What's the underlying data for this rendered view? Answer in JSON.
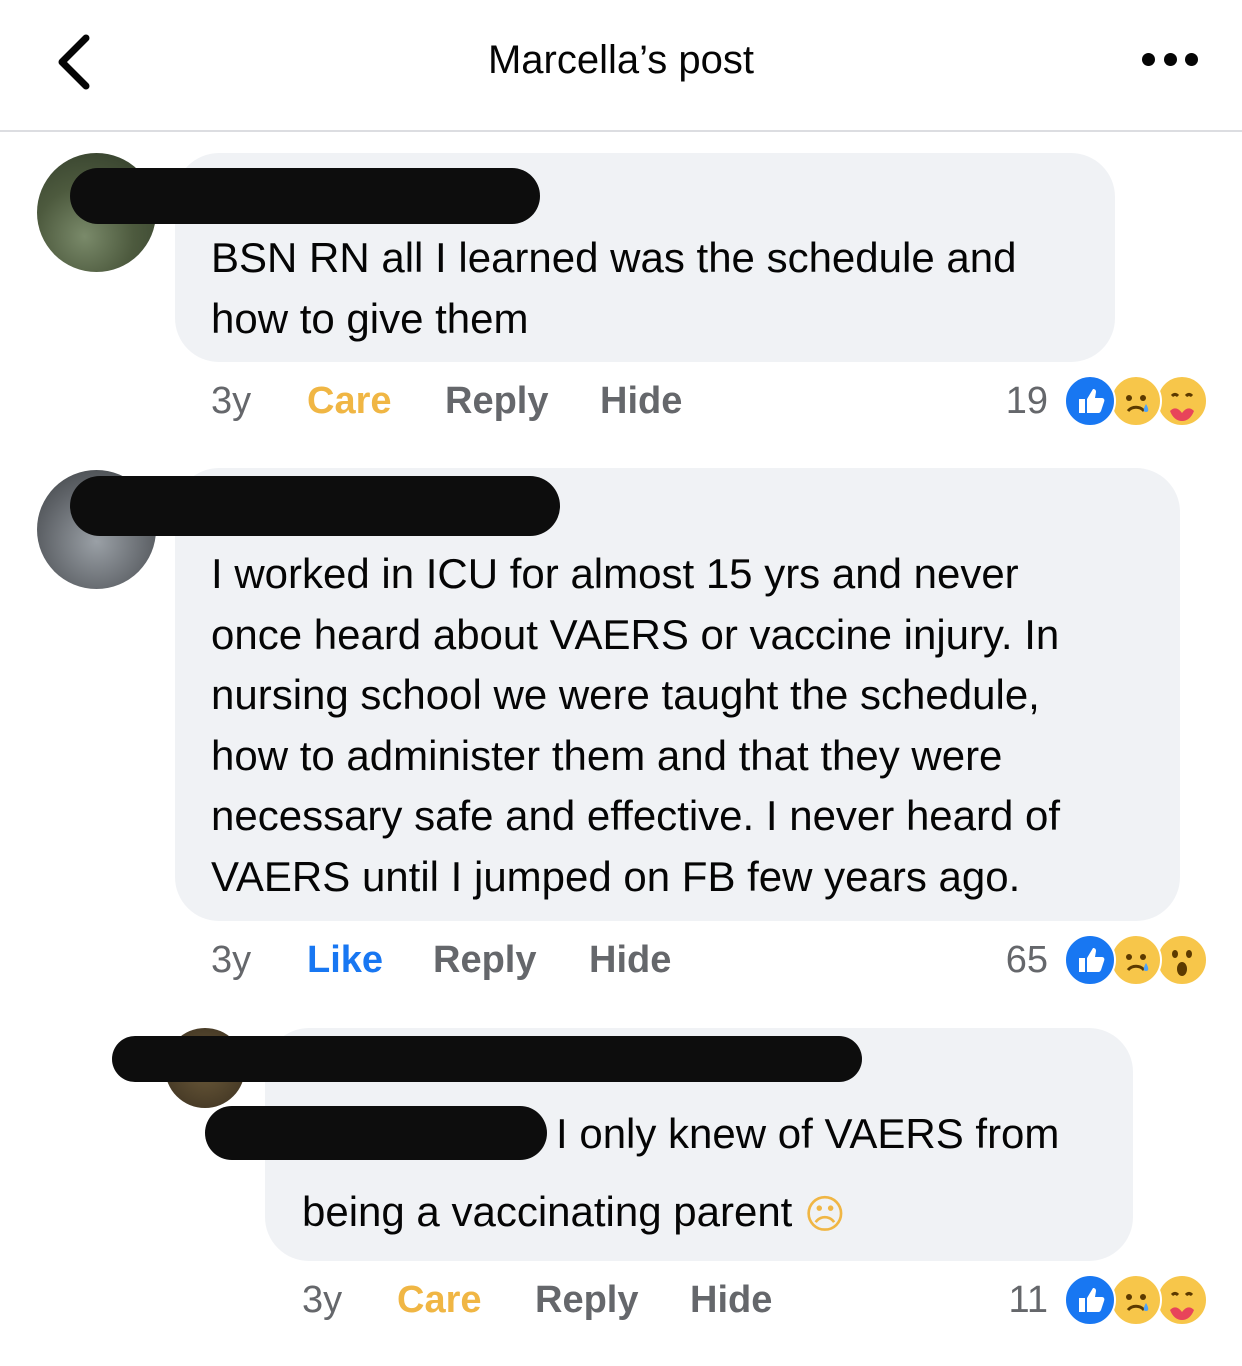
{
  "header": {
    "title": "Marcella’s post"
  },
  "comments": [
    {
      "text_lines": [
        "BSN RN all I learned was the schedule and",
        "how to give them"
      ],
      "age": "3y",
      "reaction_label": "Care",
      "reply_label": "Reply",
      "hide_label": "Hide",
      "reaction_count": "19",
      "reactions": [
        "like",
        "sad",
        "care"
      ]
    },
    {
      "text_lines": [
        "I worked in ICU for almost 15 yrs and never",
        "once heard about VAERS or vaccine injury. In",
        "nursing school we were taught the schedule,",
        "how to administer them and that they were",
        "necessary safe and effective. I never heard of",
        "VAERS until I jumped on FB few years ago."
      ],
      "age": "3y",
      "reaction_label": "Like",
      "reply_label": "Reply",
      "hide_label": "Hide",
      "reaction_count": "65",
      "reactions": [
        "like",
        "sad",
        "wow"
      ]
    },
    {
      "text_lines": [
        "I only knew of VAERS from",
        "being a vaccinating parent"
      ],
      "emoji": "☹",
      "age": "3y",
      "reaction_label": "Care",
      "reply_label": "Reply",
      "hide_label": "Hide",
      "reaction_count": "11",
      "reactions": [
        "like",
        "sad",
        "care"
      ]
    }
  ],
  "colors": {
    "accent_like": "#1877f2",
    "accent_care": "#f0b644",
    "meta_text": "#65676b",
    "bubble": "#f0f2f5"
  }
}
